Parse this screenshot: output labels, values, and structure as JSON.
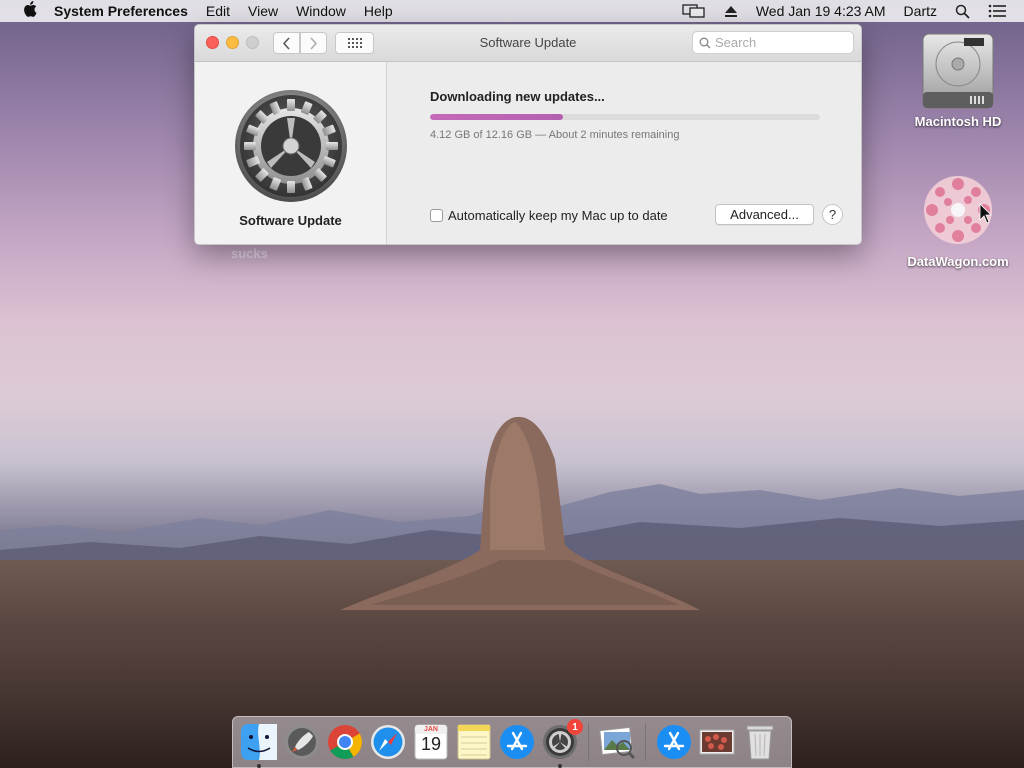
{
  "menubar": {
    "apple_icon": "apple-logo-icon",
    "app_name": "System Preferences",
    "menus": [
      "Edit",
      "View",
      "Window",
      "Help"
    ],
    "datetime": "Wed Jan 19  4:23 AM",
    "user": "Dartz",
    "status_icons": [
      "display-mirroring-icon",
      "eject-icon",
      "spotlight-search-icon",
      "notification-center-icon"
    ]
  },
  "window": {
    "title": "Software Update",
    "search_placeholder": "Search",
    "sidebar": {
      "pane_icon": "software-update-gear-icon",
      "pane_label": "Software Update"
    },
    "update": {
      "status_title": "Downloading new updates...",
      "progress_fraction": 0.34,
      "progress_text": "4.12 GB of 12.16 GB — About 2 minutes remaining",
      "auto_update_label": "Automatically keep my Mac up to date",
      "auto_update_checked": false,
      "advanced_button": "Advanced...",
      "help_button": "?"
    },
    "colors": {
      "close": "#fc605b",
      "minimize": "#fdbc40",
      "progress": "#c46bb8"
    }
  },
  "desktop": {
    "behind_window_text": "sucks",
    "icons": [
      {
        "label": "Macintosh HD",
        "icon": "hard-drive-icon"
      },
      {
        "label": "DataWagon.com",
        "icon": "flower-image-icon"
      }
    ]
  },
  "dock": {
    "items": [
      {
        "name": "Finder",
        "icon": "finder-icon",
        "running": true
      },
      {
        "name": "Launchpad",
        "icon": "launchpad-rocket-icon",
        "running": false
      },
      {
        "name": "Google Chrome",
        "icon": "chrome-icon",
        "running": false
      },
      {
        "name": "Safari",
        "icon": "safari-compass-icon",
        "running": false
      },
      {
        "name": "Calendar",
        "icon": "calendar-icon",
        "running": false,
        "month": "JAN",
        "day": "19"
      },
      {
        "name": "Notes",
        "icon": "notes-icon",
        "running": false
      },
      {
        "name": "App Store",
        "icon": "app-store-icon",
        "running": false
      },
      {
        "name": "System Preferences",
        "icon": "system-preferences-gear-icon",
        "running": true,
        "badge": "1"
      },
      {
        "name": "Preview",
        "icon": "preview-icon",
        "running": false
      },
      {
        "name": "App Store Downloads",
        "icon": "app-store-icon",
        "running": false
      },
      {
        "name": "Photos Stack",
        "icon": "photo-stack-icon",
        "running": false
      },
      {
        "name": "Trash",
        "icon": "trash-icon",
        "running": false
      }
    ]
  }
}
